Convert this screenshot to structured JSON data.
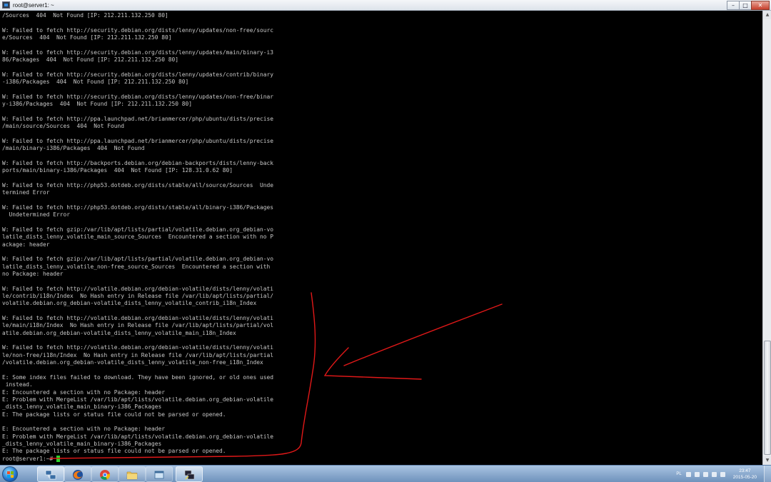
{
  "window": {
    "title": "root@server1: ~",
    "buttons": {
      "minimize": "–",
      "maximize": "□",
      "close": "✕"
    }
  },
  "terminal": {
    "lines": [
      "/Sources  404  Not Found [IP: 212.211.132.250 80]",
      "",
      "W: Failed to fetch http://security.debian.org/dists/lenny/updates/non-free/sourc",
      "e/Sources  404  Not Found [IP: 212.211.132.250 80]",
      "",
      "W: Failed to fetch http://security.debian.org/dists/lenny/updates/main/binary-i3",
      "86/Packages  404  Not Found [IP: 212.211.132.250 80]",
      "",
      "W: Failed to fetch http://security.debian.org/dists/lenny/updates/contrib/binary",
      "-i386/Packages  404  Not Found [IP: 212.211.132.250 80]",
      "",
      "W: Failed to fetch http://security.debian.org/dists/lenny/updates/non-free/binar",
      "y-i386/Packages  404  Not Found [IP: 212.211.132.250 80]",
      "",
      "W: Failed to fetch http://ppa.launchpad.net/brianmercer/php/ubuntu/dists/precise",
      "/main/source/Sources  404  Not Found",
      "",
      "W: Failed to fetch http://ppa.launchpad.net/brianmercer/php/ubuntu/dists/precise",
      "/main/binary-i386/Packages  404  Not Found",
      "",
      "W: Failed to fetch http://backports.debian.org/debian-backports/dists/lenny-back",
      "ports/main/binary-i386/Packages  404  Not Found [IP: 128.31.0.62 80]",
      "",
      "W: Failed to fetch http://php53.dotdeb.org/dists/stable/all/source/Sources  Unde",
      "termined Error",
      "",
      "W: Failed to fetch http://php53.dotdeb.org/dists/stable/all/binary-i386/Packages",
      "  Undetermined Error",
      "",
      "W: Failed to fetch gzip:/var/lib/apt/lists/partial/volatile.debian.org_debian-vo",
      "latile_dists_lenny_volatile_main_source_Sources  Encountered a section with no P",
      "ackage: header",
      "",
      "W: Failed to fetch gzip:/var/lib/apt/lists/partial/volatile.debian.org_debian-vo",
      "latile_dists_lenny_volatile_non-free_source_Sources  Encountered a section with",
      "no Package: header",
      "",
      "W: Failed to fetch http://volatile.debian.org/debian-volatile/dists/lenny/volati",
      "le/contrib/i18n/Index  No Hash entry in Release file /var/lib/apt/lists/partial/",
      "volatile.debian.org_debian-volatile_dists_lenny_volatile_contrib_i18n_Index",
      "",
      "W: Failed to fetch http://volatile.debian.org/debian-volatile/dists/lenny/volati",
      "le/main/i18n/Index  No Hash entry in Release file /var/lib/apt/lists/partial/vol",
      "atile.debian.org_debian-volatile_dists_lenny_volatile_main_i18n_Index",
      "",
      "W: Failed to fetch http://volatile.debian.org/debian-volatile/dists/lenny/volati",
      "le/non-free/i18n/Index  No Hash entry in Release file /var/lib/apt/lists/partial",
      "/volatile.debian.org_debian-volatile_dists_lenny_volatile_non-free_i18n_Index",
      "",
      "E: Some index files failed to download. They have been ignored, or old ones used",
      " instead.",
      "E: Encountered a section with no Package: header",
      "E: Problem with MergeList /var/lib/apt/lists/volatile.debian.org_debian-volatile",
      "_dists_lenny_volatile_main_binary-i386_Packages",
      "E: The package lists or status file could not be parsed or opened.",
      "",
      "E: Encountered a section with no Package: header",
      "E: Problem with MergeList /var/lib/apt/lists/volatile.debian.org_debian-volatile",
      "_dists_lenny_volatile_main_binary-i386_Packages",
      "E: The package lists or status file could not be parsed or opened."
    ],
    "prompt": "root@server1:~#",
    "cursor_color": "#2bd42b",
    "text_color": "#c7c7c7",
    "annotation_color": "#e01818"
  },
  "taskbar": {
    "start_icon": "windows-start-orb",
    "buttons": [
      {
        "icon": "network-icon",
        "active": true
      },
      {
        "icon": "firefox-icon",
        "active": false
      },
      {
        "icon": "chrome-icon",
        "active": false
      },
      {
        "icon": "folder-icon",
        "active": false
      },
      {
        "icon": "window-icon",
        "active": false
      },
      {
        "icon": "putty-icon",
        "active": true
      }
    ],
    "tray": {
      "language": "PL",
      "time": "23:47",
      "date": "2015-05-20"
    }
  }
}
